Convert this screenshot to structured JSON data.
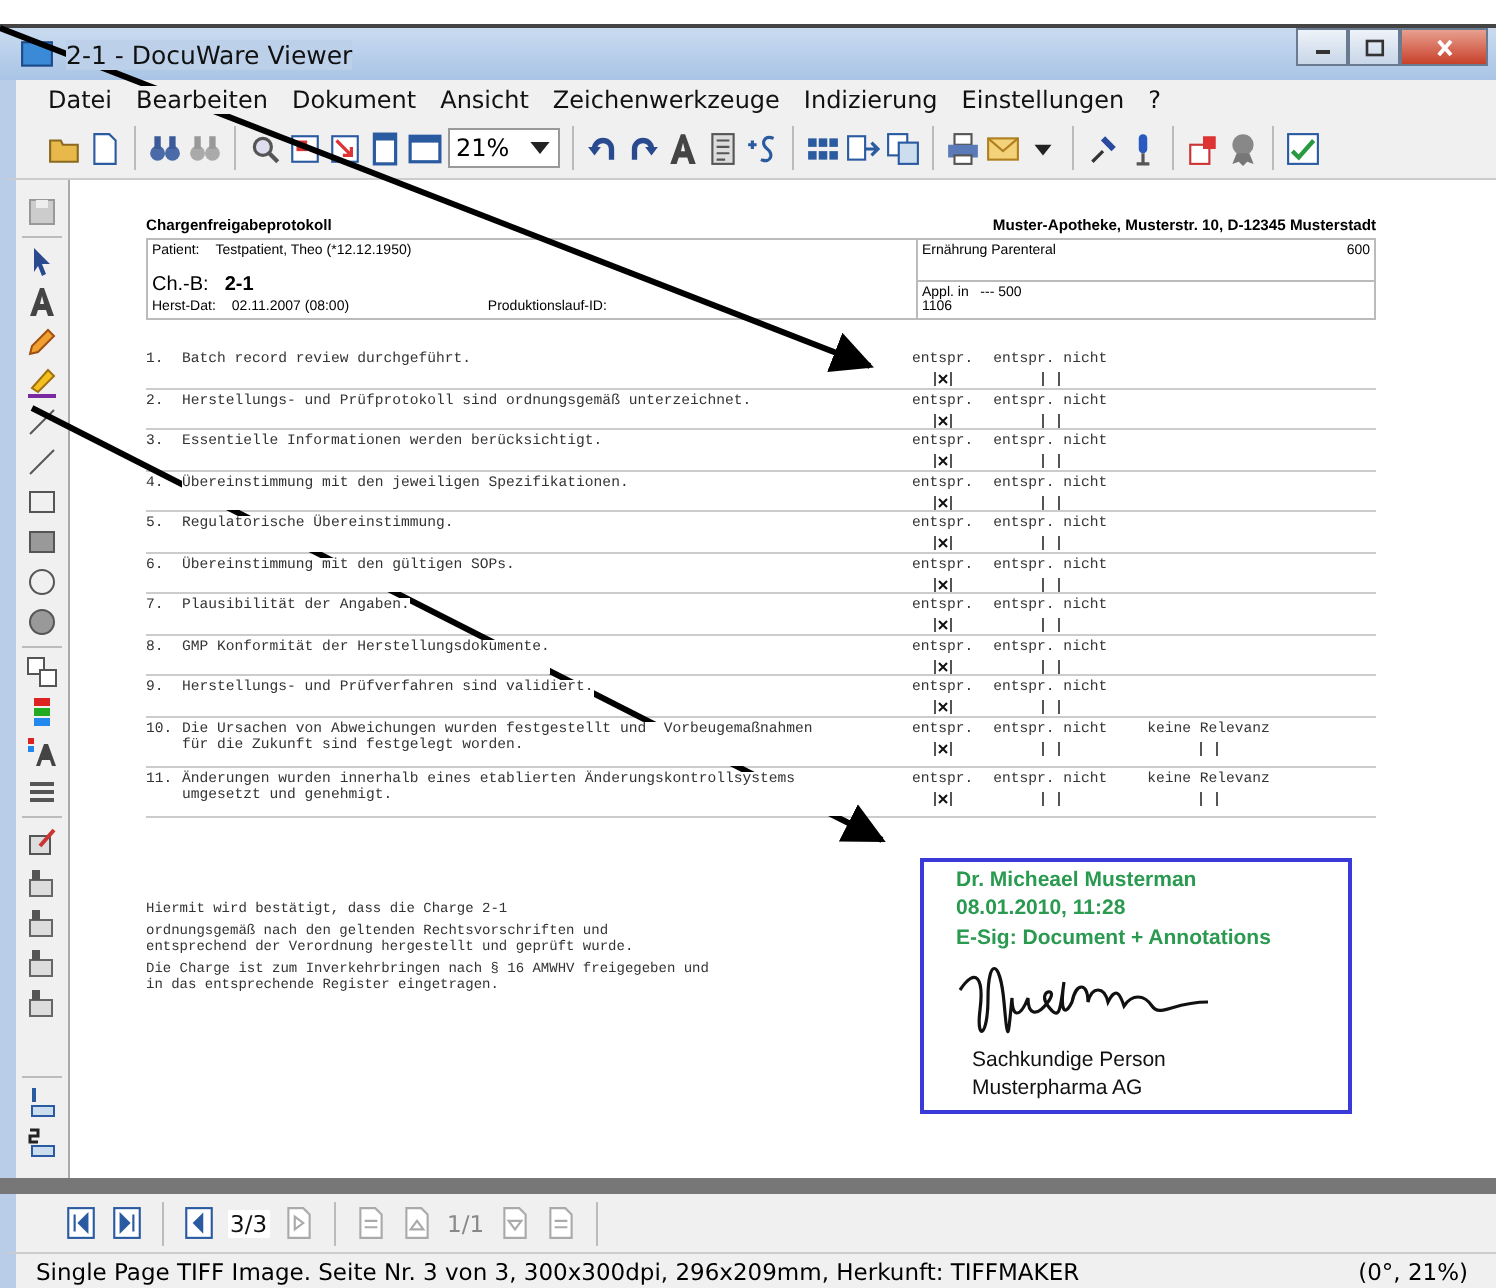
{
  "window": {
    "title": "2-1 - DocuWare Viewer"
  },
  "menu": [
    "Datei",
    "Bearbeiten",
    "Dokument",
    "Ansicht",
    "Zeichenwerkzeuge",
    "Indizierung",
    "Einstellungen",
    "?"
  ],
  "toolbar": {
    "zoom": "21%"
  },
  "document": {
    "title": "Chargenfreigabeprotokoll",
    "company": "Muster-Apotheke, Musterstr. 10, D-12345 Musterstadt",
    "header": {
      "patient_label": "Patient:",
      "patient": "Testpatient, Theo (*12.12.1950)",
      "batch_label": "Ch.-B:",
      "batch": "2-1",
      "date_label": "Herst-Dat:",
      "date": "02.11.2007 (08:00)",
      "run_label": "Produktionslauf-ID:",
      "product": "Ernährung Parenteral",
      "product_value": "600",
      "application": "Appl. in   --- 500",
      "id": "1106"
    },
    "items": [
      {
        "number": "1.",
        "text": "Batch record review durchgeführt.",
        "options": [
          {
            "label": "entspr.",
            "checked": true
          },
          {
            "label": "entspr. nicht",
            "checked": false
          }
        ]
      },
      {
        "number": "2.",
        "text": "Herstellungs- und Prüfprotokoll sind ordnungsgemäß unterzeichnet.",
        "options": [
          {
            "label": "entspr.",
            "checked": true
          },
          {
            "label": "entspr. nicht",
            "checked": false
          }
        ]
      },
      {
        "number": "3.",
        "text": "Essentielle Informationen werden berücksichtigt.",
        "options": [
          {
            "label": "entspr.",
            "checked": true
          },
          {
            "label": "entspr. nicht",
            "checked": false
          }
        ]
      },
      {
        "number": "4.",
        "text": "Übereinstimmung mit den jeweiligen Spezifikationen.",
        "options": [
          {
            "label": "entspr.",
            "checked": true
          },
          {
            "label": "entspr. nicht",
            "checked": false
          }
        ]
      },
      {
        "number": "5.",
        "text": "Regulatorische Übereinstimmung.",
        "options": [
          {
            "label": "entspr.",
            "checked": true
          },
          {
            "label": "entspr. nicht",
            "checked": false
          }
        ]
      },
      {
        "number": "6.",
        "text": "Übereinstimmung mit den gültigen SOPs.",
        "options": [
          {
            "label": "entspr.",
            "checked": true
          },
          {
            "label": "entspr. nicht",
            "checked": false
          }
        ]
      },
      {
        "number": "7.",
        "text": "Plausibilität der Angaben.",
        "options": [
          {
            "label": "entspr.",
            "checked": true
          },
          {
            "label": "entspr. nicht",
            "checked": false
          }
        ]
      },
      {
        "number": "8.",
        "text": "GMP Konformität der Herstellungsdokumente.",
        "options": [
          {
            "label": "entspr.",
            "checked": true
          },
          {
            "label": "entspr. nicht",
            "checked": false
          }
        ]
      },
      {
        "number": "9.",
        "text": "Herstellungs- und Prüfverfahren sind validiert.",
        "options": [
          {
            "label": "entspr.",
            "checked": true
          },
          {
            "label": "entspr. nicht",
            "checked": false
          }
        ]
      },
      {
        "number": "10.",
        "text": "Die Ursachen von Abweichungen wurden festgestellt und  Vorbeugemaßnahmen für die Zukunft sind festgelegt worden.",
        "options": [
          {
            "label": "entspr.",
            "checked": true
          },
          {
            "label": "entspr. nicht",
            "checked": false
          },
          {
            "label": "keine Relevanz",
            "checked": false
          }
        ]
      },
      {
        "number": "11.",
        "text": "Änderungen wurden innerhalb eines etablierten Änderungskontrollsystems umgesetzt und genehmigt.",
        "options": [
          {
            "label": "entspr.",
            "checked": true
          },
          {
            "label": "entspr. nicht",
            "checked": false
          },
          {
            "label": "keine Relevanz",
            "checked": false
          }
        ]
      }
    ],
    "confirmation": [
      "Hiermit wird bestätigt, dass die Charge  2-1",
      "ordnungsgemäß nach den geltenden Rechtsvorschriften und entsprechend der Verordnung hergestellt und geprüft wurde.",
      "Die Charge ist zum Inverkehrbringen nach § 16 AMWHV freigegeben und in das entsprechende Register eingetragen."
    ],
    "signature": {
      "name": "Dr. Micheael Musterman",
      "timestamp": "08.01.2010, 11:28",
      "esig": "E-Sig: Document + Annotations",
      "role": "Sachkundige Person",
      "company": "Musterpharma AG"
    }
  },
  "navigation": {
    "document_pages": "3/3",
    "pages": "1/1"
  },
  "status_bar": {
    "text": "Single Page TIFF Image. Seite Nr. 3 von 3, 300x300dpi, 296x209mm, Herkunft: TIFFMAKER",
    "zoom": "(0°, 21%)"
  }
}
